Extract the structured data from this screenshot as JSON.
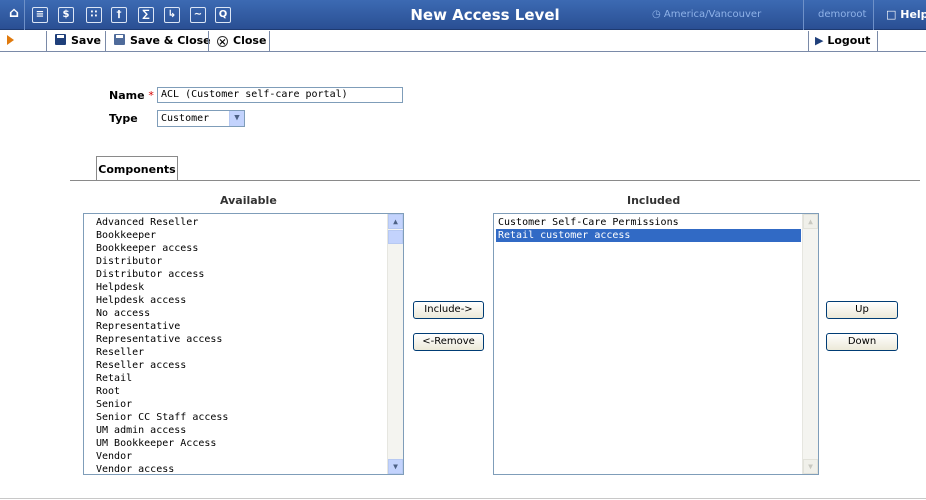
{
  "window": {
    "title": "New Access Level",
    "timezone": "America/Vancouver",
    "user": "demoroot",
    "help": "Help"
  },
  "nav_icons": [
    "home-icon",
    "list-icon",
    "dollar-icon",
    "grid-icon",
    "figure-icon",
    "columns-icon",
    "export-icon",
    "chart-icon",
    "search-icon"
  ],
  "toolbar": {
    "save": "Save",
    "save_close": "Save & Close",
    "close": "Close",
    "logout": "Logout"
  },
  "form": {
    "name_label": "Name",
    "required_mark": "*",
    "name_value": "ACL (Customer self-care portal)",
    "type_label": "Type",
    "type_value": "Customer"
  },
  "tabs": [
    {
      "label": "Components"
    }
  ],
  "available": {
    "heading": "Available",
    "items": [
      "Advanced Reseller",
      "Bookkeeper",
      "Bookkeeper access",
      "Distributor",
      "Distributor access",
      "Helpdesk",
      "Helpdesk access",
      "No access",
      "Representative",
      "Representative access",
      "Reseller",
      "Reseller access",
      "Retail",
      "Root",
      "Senior",
      "Senior CC Staff access",
      "UM admin access",
      "UM Bookkeeper Access",
      "Vendor",
      "Vendor access"
    ]
  },
  "included": {
    "heading": "Included",
    "items": [
      "Customer Self-Care Permissions",
      "Retail customer access"
    ],
    "selected_index": 1
  },
  "buttons": {
    "include": "Include->",
    "remove": "<-Remove",
    "up": "Up",
    "down": "Down"
  },
  "colors": {
    "nav_bg": "#2f5a9e",
    "accent_arrow": "#e07a0d",
    "selection": "#316ac5",
    "required": "#d40000"
  }
}
